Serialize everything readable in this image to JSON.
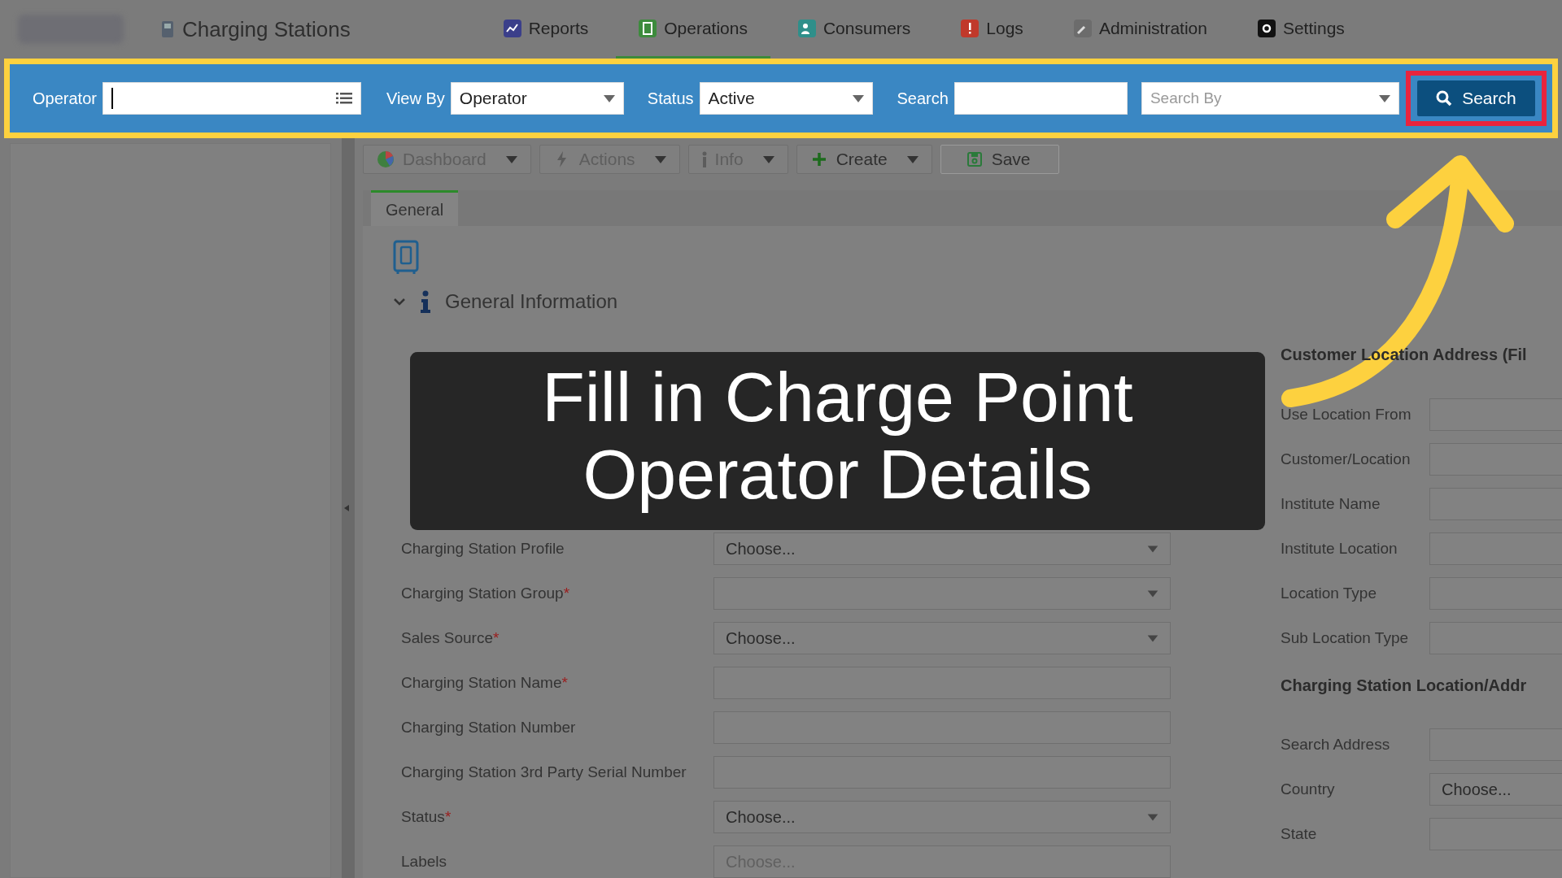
{
  "app": {
    "title": "Charging Stations"
  },
  "nav_tabs": [
    {
      "label": "Reports",
      "kind": "chart",
      "selected": false
    },
    {
      "label": "Operations",
      "kind": "grid",
      "selected": true
    },
    {
      "label": "Consumers",
      "kind": "people",
      "selected": false
    },
    {
      "label": "Logs",
      "kind": "alert",
      "selected": false
    },
    {
      "label": "Administration",
      "kind": "wrench",
      "selected": false
    },
    {
      "label": "Settings",
      "kind": "gear",
      "selected": false
    }
  ],
  "filter_bar": {
    "operator": {
      "label": "Operator",
      "focused": true
    },
    "view_by": {
      "label": "View By",
      "value": "Operator"
    },
    "status": {
      "label": "Status",
      "value": "Active"
    },
    "search": {
      "label": "Search"
    },
    "search_by": {
      "placeholder": "Search By"
    },
    "search_button": "Search"
  },
  "toolbar": [
    {
      "label": "Dashboard",
      "kind": "pie",
      "disabled": true,
      "dropdown": true
    },
    {
      "label": "Actions",
      "kind": "bolt",
      "disabled": true,
      "dropdown": true
    },
    {
      "label": "Info",
      "kind": "info",
      "disabled": true,
      "dropdown": true
    },
    {
      "label": "Create",
      "kind": "plus",
      "disabled": false,
      "dropdown": true
    },
    {
      "label": "Save",
      "kind": "disk",
      "disabled": false,
      "dropdown": false
    }
  ],
  "tabs": [
    {
      "label": "General",
      "selected": true
    }
  ],
  "section": {
    "title": "General Information",
    "expanded": true
  },
  "left_form": {
    "fields": [
      {
        "label": "Charging Station Profile",
        "kind": "select",
        "value": "Choose..."
      },
      {
        "label": "Charging Station Group",
        "required_mark": "*",
        "kind": "select"
      },
      {
        "label": "Sales Source",
        "required_mark": "*",
        "kind": "select",
        "value": "Choose..."
      },
      {
        "label": "Charging Station Name",
        "required_mark": "*",
        "kind": "text"
      },
      {
        "label": "Charging Station Number",
        "kind": "text"
      },
      {
        "label": "Charging Station 3rd Party Serial Number",
        "kind": "text"
      },
      {
        "label": "Status",
        "required_mark": "*",
        "kind": "select",
        "value": "Choose..."
      },
      {
        "label": "Labels",
        "kind": "multi",
        "placeholder": "Choose..."
      }
    ]
  },
  "right_form": {
    "sections": [
      {
        "heading": "Customer Location Address (Fil",
        "fields": [
          {
            "label": "Use Location From"
          },
          {
            "label": "Customer/Location"
          },
          {
            "label": "Institute Name"
          },
          {
            "label": "Institute Location"
          },
          {
            "label": "Location Type"
          },
          {
            "label": "Sub Location Type"
          }
        ]
      },
      {
        "heading": "Charging Station Location/Addr",
        "fields": [
          {
            "label": "Search Address"
          },
          {
            "label": "Country",
            "value": "Choose..."
          },
          {
            "label": "State"
          }
        ]
      }
    ]
  },
  "caption": {
    "text": "Fill in Charge Point Operator Details"
  }
}
